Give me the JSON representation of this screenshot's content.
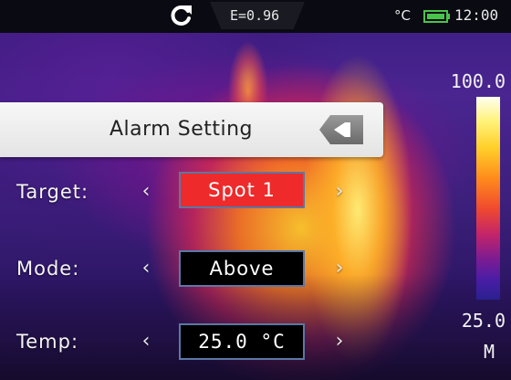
{
  "status_bar": {
    "emissivity": "E=0.96",
    "unit": "°C",
    "clock": "12:00",
    "refresh_icon": "refresh-icon",
    "battery_icon": "battery-icon",
    "battery_color": "#49c44a"
  },
  "scale": {
    "max": "100.0",
    "min": "25.0",
    "mode": "M"
  },
  "alarm": {
    "title": "Alarm Setting",
    "back_icon": "back-arrow-icon",
    "rows": [
      {
        "label": "Target:",
        "value": "Spot 1",
        "value_bg": "#ee2a2a"
      },
      {
        "label": "Mode:",
        "value": "Above",
        "value_bg": "#000000"
      },
      {
        "label": "Temp:",
        "value": "25.0 °C",
        "value_bg": "#000000"
      }
    ],
    "arrow_left": "‹",
    "arrow_right": "›"
  }
}
